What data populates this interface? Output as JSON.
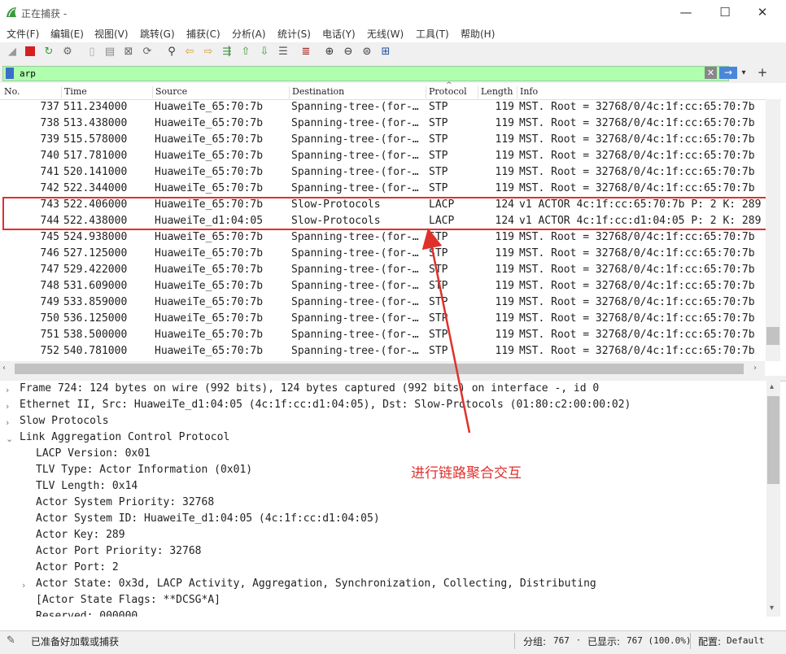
{
  "window": {
    "title": "正在捕获 -",
    "min": "—",
    "max": "☐",
    "close": "✕"
  },
  "menu": [
    "文件(F)",
    "编辑(E)",
    "视图(V)",
    "跳转(G)",
    "捕获(C)",
    "分析(A)",
    "统计(S)",
    "电话(Y)",
    "无线(W)",
    "工具(T)",
    "帮助(H)"
  ],
  "filter": {
    "value": "arp",
    "apply_glyph": "→",
    "add_glyph": "+"
  },
  "columns": [
    "No.",
    "Time",
    "Source",
    "Destination",
    "Protocol",
    "Length",
    "Info"
  ],
  "packets": [
    {
      "no": "737",
      "time": "511.234000",
      "src": "HuaweiTe_65:70:7b",
      "dst": "Spanning-tree-(for-…",
      "proto": "STP",
      "len": "119",
      "info": "MST. Root = 32768/0/4c:1f:cc:65:70:7b"
    },
    {
      "no": "738",
      "time": "513.438000",
      "src": "HuaweiTe_65:70:7b",
      "dst": "Spanning-tree-(for-…",
      "proto": "STP",
      "len": "119",
      "info": "MST. Root = 32768/0/4c:1f:cc:65:70:7b"
    },
    {
      "no": "739",
      "time": "515.578000",
      "src": "HuaweiTe_65:70:7b",
      "dst": "Spanning-tree-(for-…",
      "proto": "STP",
      "len": "119",
      "info": "MST. Root = 32768/0/4c:1f:cc:65:70:7b"
    },
    {
      "no": "740",
      "time": "517.781000",
      "src": "HuaweiTe_65:70:7b",
      "dst": "Spanning-tree-(for-…",
      "proto": "STP",
      "len": "119",
      "info": "MST. Root = 32768/0/4c:1f:cc:65:70:7b"
    },
    {
      "no": "741",
      "time": "520.141000",
      "src": "HuaweiTe_65:70:7b",
      "dst": "Spanning-tree-(for-…",
      "proto": "STP",
      "len": "119",
      "info": "MST. Root = 32768/0/4c:1f:cc:65:70:7b"
    },
    {
      "no": "742",
      "time": "522.344000",
      "src": "HuaweiTe_65:70:7b",
      "dst": "Spanning-tree-(for-…",
      "proto": "STP",
      "len": "119",
      "info": "MST. Root = 32768/0/4c:1f:cc:65:70:7b"
    },
    {
      "no": "743",
      "time": "522.406000",
      "src": "HuaweiTe_65:70:7b",
      "dst": "Slow-Protocols",
      "proto": "LACP",
      "len": "124",
      "info": "v1 ACTOR 4c:1f:cc:65:70:7b P: 2 K: 289"
    },
    {
      "no": "744",
      "time": "522.438000",
      "src": "HuaweiTe_d1:04:05",
      "dst": "Slow-Protocols",
      "proto": "LACP",
      "len": "124",
      "info": "v1 ACTOR 4c:1f:cc:d1:04:05 P: 2 K: 289"
    },
    {
      "no": "745",
      "time": "524.938000",
      "src": "HuaweiTe_65:70:7b",
      "dst": "Spanning-tree-(for-…",
      "proto": "STP",
      "len": "119",
      "info": "MST. Root = 32768/0/4c:1f:cc:65:70:7b"
    },
    {
      "no": "746",
      "time": "527.125000",
      "src": "HuaweiTe_65:70:7b",
      "dst": "Spanning-tree-(for-…",
      "proto": "STP",
      "len": "119",
      "info": "MST. Root = 32768/0/4c:1f:cc:65:70:7b"
    },
    {
      "no": "747",
      "time": "529.422000",
      "src": "HuaweiTe_65:70:7b",
      "dst": "Spanning-tree-(for-…",
      "proto": "STP",
      "len": "119",
      "info": "MST. Root = 32768/0/4c:1f:cc:65:70:7b"
    },
    {
      "no": "748",
      "time": "531.609000",
      "src": "HuaweiTe_65:70:7b",
      "dst": "Spanning-tree-(for-…",
      "proto": "STP",
      "len": "119",
      "info": "MST. Root = 32768/0/4c:1f:cc:65:70:7b"
    },
    {
      "no": "749",
      "time": "533.859000",
      "src": "HuaweiTe_65:70:7b",
      "dst": "Spanning-tree-(for-…",
      "proto": "STP",
      "len": "119",
      "info": "MST. Root = 32768/0/4c:1f:cc:65:70:7b"
    },
    {
      "no": "750",
      "time": "536.125000",
      "src": "HuaweiTe_65:70:7b",
      "dst": "Spanning-tree-(for-…",
      "proto": "STP",
      "len": "119",
      "info": "MST. Root = 32768/0/4c:1f:cc:65:70:7b"
    },
    {
      "no": "751",
      "time": "538.500000",
      "src": "HuaweiTe_65:70:7b",
      "dst": "Spanning-tree-(for-…",
      "proto": "STP",
      "len": "119",
      "info": "MST. Root = 32768/0/4c:1f:cc:65:70:7b"
    },
    {
      "no": "752",
      "time": "540.781000",
      "src": "HuaweiTe_65:70:7b",
      "dst": "Spanning-tree-(for-…",
      "proto": "STP",
      "len": "119",
      "info": "MST. Root = 32768/0/4c:1f:cc:65:70:7b"
    }
  ],
  "details": [
    {
      "indent": 0,
      "expander": "›",
      "text": "Frame 724: 124 bytes on wire (992 bits), 124 bytes captured (992 bits) on interface -, id 0"
    },
    {
      "indent": 0,
      "expander": "›",
      "text": "Ethernet II, Src: HuaweiTe_d1:04:05 (4c:1f:cc:d1:04:05), Dst: Slow-Protocols (01:80:c2:00:00:02)"
    },
    {
      "indent": 0,
      "expander": "›",
      "text": "Slow Protocols"
    },
    {
      "indent": 0,
      "expander": "⌄",
      "text": "Link Aggregation Control Protocol"
    },
    {
      "indent": 1,
      "expander": "",
      "text": "LACP Version: 0x01"
    },
    {
      "indent": 1,
      "expander": "",
      "text": "TLV Type: Actor Information (0x01)"
    },
    {
      "indent": 1,
      "expander": "",
      "text": "TLV Length: 0x14"
    },
    {
      "indent": 1,
      "expander": "",
      "text": "Actor System Priority: 32768"
    },
    {
      "indent": 1,
      "expander": "",
      "text": "Actor System ID: HuaweiTe_d1:04:05 (4c:1f:cc:d1:04:05)"
    },
    {
      "indent": 1,
      "expander": "",
      "text": "Actor Key: 289"
    },
    {
      "indent": 1,
      "expander": "",
      "text": "Actor Port Priority: 32768"
    },
    {
      "indent": 1,
      "expander": "",
      "text": "Actor Port: 2"
    },
    {
      "indent": 1,
      "expander": "›",
      "text": "Actor State: 0x3d, LACP Activity, Aggregation, Synchronization, Collecting, Distributing"
    },
    {
      "indent": 1,
      "expander": "",
      "text": "[Actor State Flags: **DCSG*A]"
    },
    {
      "indent": 1,
      "expander": "",
      "text": "Reserved: 000000"
    }
  ],
  "annotation": {
    "text": "进行链路聚合交互",
    "color": "#e0302c"
  },
  "status": {
    "ready": "已准备好加载或捕获",
    "packets_label": "分组:",
    "packets_value": "767",
    "dot": "·",
    "displayed_label": "已显示:",
    "displayed_value": "767 (100.0%)",
    "profile_label": "配置:",
    "profile_value": "Default"
  },
  "colors": {
    "filter_bg": "#afffaf",
    "highlight_box": "#e0302c"
  }
}
